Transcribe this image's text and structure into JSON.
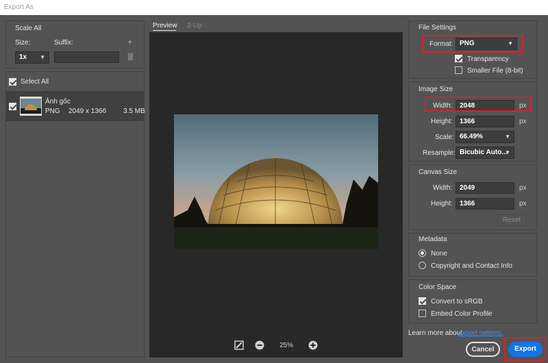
{
  "window": {
    "title": "Export As"
  },
  "left": {
    "scale_all": "Scale All",
    "size_label": "Size:",
    "suffix_label": "Suffix:",
    "size_value": "1x",
    "suffix_value": "",
    "select_all": "Select All",
    "asset": {
      "name": "Ảnh gốc",
      "format": "PNG",
      "dimensions": "2049 x 1366",
      "filesize": "3.5 MB"
    }
  },
  "preview": {
    "tabs": [
      "Preview",
      "2-Up"
    ],
    "zoom": "25%"
  },
  "file_settings": {
    "title": "File Settings",
    "format_label": "Format:",
    "format_value": "PNG",
    "transparency": "Transparency",
    "smaller_file": "Smaller File (8-bit)"
  },
  "image_size": {
    "title": "Image Size",
    "width_label": "Width:",
    "width_value": "2048",
    "height_label": "Height:",
    "height_value": "1366",
    "scale_label": "Scale:",
    "scale_value": "66.49%",
    "resample_label": "Resample:",
    "resample_value": "Bicubic Auto...",
    "unit": "px"
  },
  "canvas_size": {
    "title": "Canvas Size",
    "width_label": "Width:",
    "width_value": "2049",
    "height_label": "Height:",
    "height_value": "1366",
    "unit": "px",
    "reset": "Reset"
  },
  "metadata": {
    "title": "Metadata",
    "none": "None",
    "copyright": "Copyright and Contact Info"
  },
  "color_space": {
    "title": "Color Space",
    "convert": "Convert to sRGB",
    "embed": "Embed Color Profile"
  },
  "footer": {
    "learn_more": "Learn more about",
    "export_options": "export options.",
    "cancel": "Cancel",
    "export": "Export"
  },
  "colors": {
    "accent": "#1473e6",
    "highlight": "#d8222a",
    "link": "#3d8bff"
  }
}
